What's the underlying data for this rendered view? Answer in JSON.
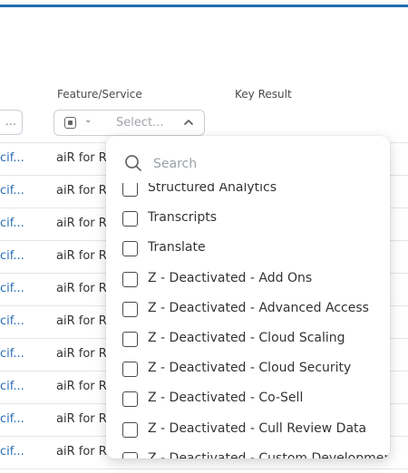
{
  "columns": {
    "feature_service": "Feature/Service",
    "key_result": "Key Result"
  },
  "prev_filter_text": "...",
  "feature_filter": {
    "placeholder": "Select...",
    "icon": "square-select-icon",
    "chevron": "chevron-up-icon"
  },
  "rows": [
    {
      "link": "cif...",
      "feature": "aiR for R"
    },
    {
      "link": "cif...",
      "feature": "aiR for R"
    },
    {
      "link": "cif...",
      "feature": "aiR for R"
    },
    {
      "link": "cif...",
      "feature": "aiR for R"
    },
    {
      "link": "cif...",
      "feature": "aiR for R"
    },
    {
      "link": "cif...",
      "feature": "aiR for R"
    },
    {
      "link": "cif...",
      "feature": "aiR for R"
    },
    {
      "link": "cif...",
      "feature": "aiR for R"
    },
    {
      "link": "cif...",
      "feature": "aiR for R"
    },
    {
      "link": "cif...",
      "feature": "aiR for R"
    }
  ],
  "dropdown": {
    "search_placeholder": "Search",
    "options": [
      "Structured Analytics",
      "Transcripts",
      "Translate",
      "Z - Deactivated - Add Ons",
      "Z - Deactivated - Advanced Access",
      "Z - Deactivated - Cloud Scaling",
      "Z - Deactivated - Cloud Security",
      "Z - Deactivated - Co-Sell",
      "Z - Deactivated - Cull Review Data",
      "Z - Deactivated - Custom Development"
    ]
  },
  "colors": {
    "accent": "#1f6fb2",
    "link": "#2a6db3",
    "border": "#c9ced6"
  }
}
